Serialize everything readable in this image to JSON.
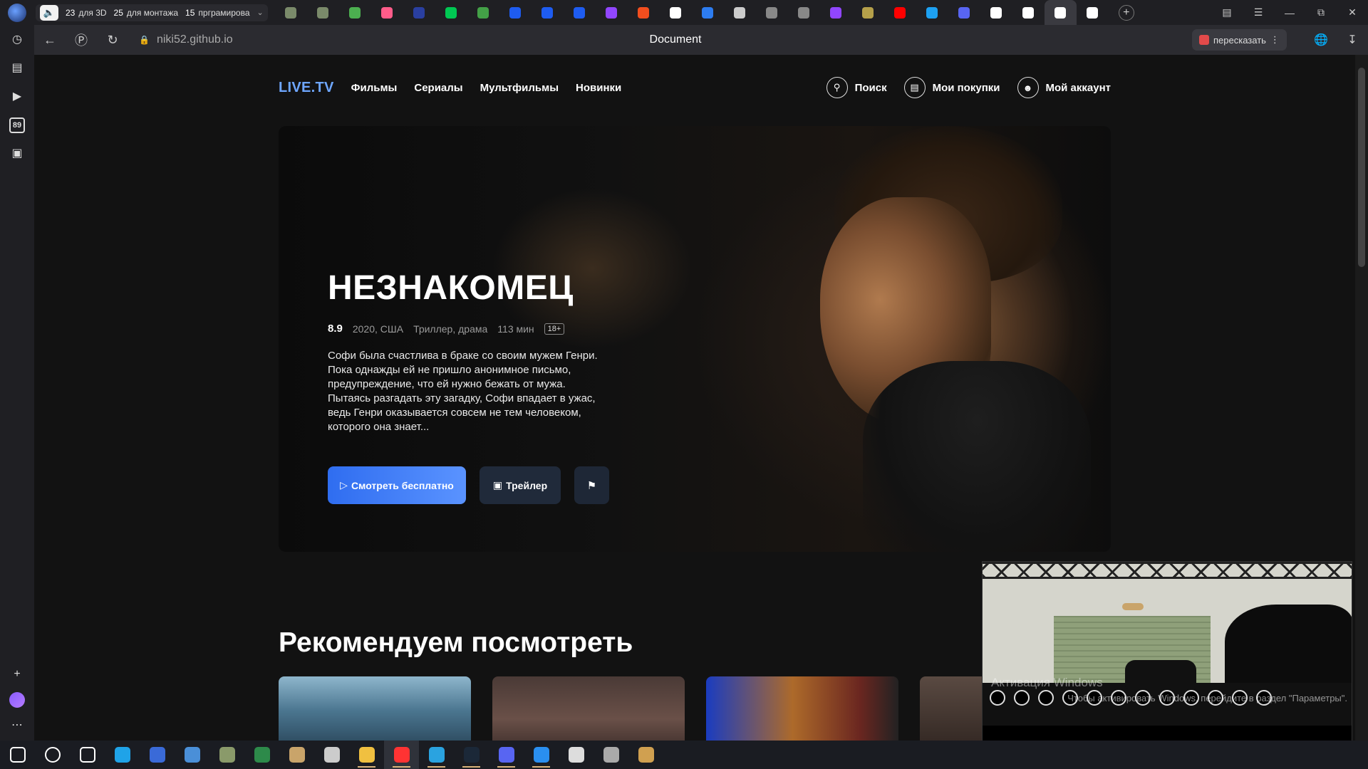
{
  "browser": {
    "tab_groups": [
      {
        "count": "23",
        "label": "для 3D"
      },
      {
        "count": "25",
        "label": "для монтажа"
      },
      {
        "count": "15",
        "label": "прграмирова"
      }
    ],
    "pinned_tab_colors": [
      "#7a8a6a",
      "#7a8a6a",
      "#4caf50",
      "#ff5c8a",
      "#2a3fa0",
      "#00c853",
      "#43a047",
      "#1e5cf0",
      "#1e5cf0",
      "#1e5cf0",
      "#9146ff",
      "#f24e1e",
      "#ffffff",
      "#2d7cf0",
      "#cccccc",
      "#888888",
      "#888888",
      "#9146ff",
      "#b5a04a",
      "#ff0000",
      "#1da1f2",
      "#5865f2",
      "#ffffff",
      "#ffffff",
      "#ffffff",
      "#ffffff"
    ],
    "url": "niki52.github.io",
    "page_title": "Document",
    "retell_label": "пересказать"
  },
  "sidebar": {
    "badge_number": "89"
  },
  "site": {
    "brand": "LIVE.TV",
    "nav": [
      "Фильмы",
      "Сериалы",
      "Мультфильмы",
      "Новинки"
    ],
    "search_label": "Поиск",
    "purchases_label": "Мои покупки",
    "account_label": "Мой аккаунт"
  },
  "hero": {
    "title": "НЕЗНАКОМЕЦ",
    "rating": "8.9",
    "year_country": "2020, США",
    "genres": "Триллер, драма",
    "duration": "113 мин",
    "age": "18+",
    "description": "Софи была счастлива в браке со своим мужем Генри. Пока однажды ей не пришло анонимное письмо, предупреждение, что ей нужно бежать от мужа. Пытаясь разгадать эту загадку, Софи впадает в ужас, ведь Генри оказывается совсем не тем человеком, которого она знает...",
    "watch_label": "Смотреть бесплатно",
    "trailer_label": "Трейлер"
  },
  "recommend": {
    "title": "Рекомендуем посмотреть"
  },
  "pip": {
    "activation_title": "Активация Windows",
    "activation_sub": "Чтобы активировать Windows, перейдите в раздел \"Параметры\"."
  },
  "taskbar": {
    "icon_colors": [
      "#ffffff",
      "#ffffff",
      "#ffffff",
      "#1fa3e8",
      "#3a6ad8",
      "#4a8fd8",
      "#8a9a6a",
      "#2d8a4a",
      "#c9a46a",
      "#cccccc",
      "#f0c040",
      "#ff3333",
      "#2aa3e0",
      "#1b2838",
      "#5865f2",
      "#2a8ff0",
      "#dddddd",
      "#aaaaaa",
      "#d0a050"
    ]
  }
}
